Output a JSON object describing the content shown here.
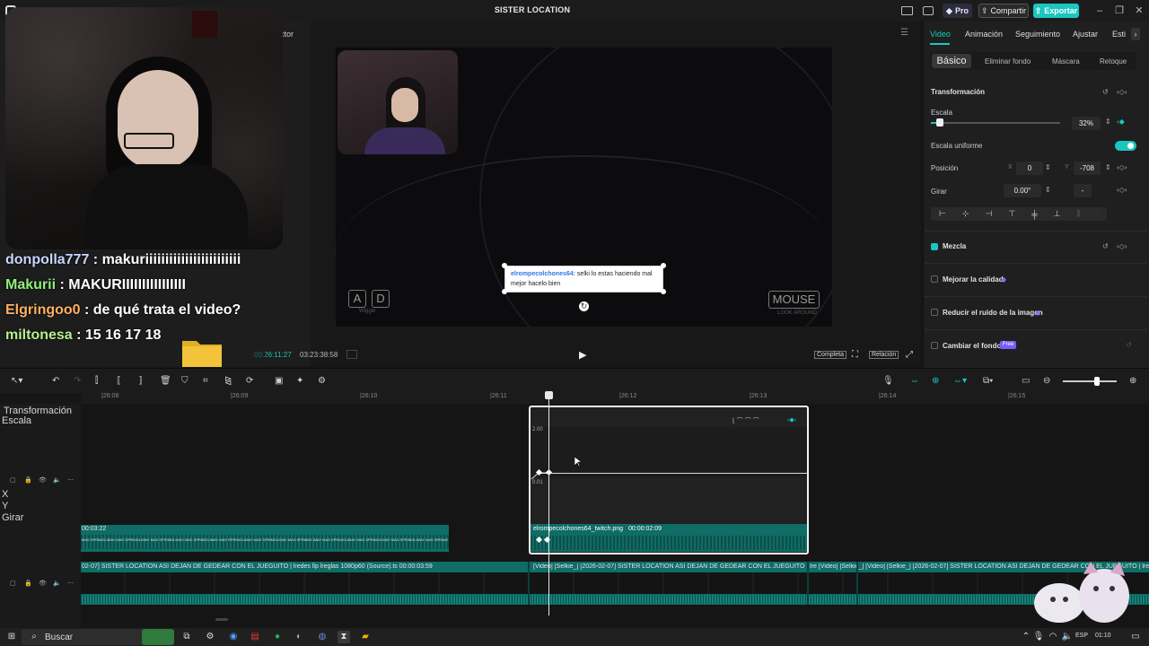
{
  "window": {
    "title": "SISTER LOCATION",
    "pro_label": "Pro",
    "share_label": "Compartir",
    "export_label": "Exportar"
  },
  "player": {
    "tab_label": "ctor",
    "current_time": "00:26:11:27",
    "total_time": "03:23:38:58",
    "complete_label": "Completa",
    "ratio_label": "Relación",
    "chat_user": "elrompecolchones64:",
    "chat_msg": "selki lo estas haciendo mal mejor hacelo bien",
    "key_a": "A",
    "key_d": "D",
    "key_sub": "Wiggle",
    "mouse_label": "MOUSE",
    "mouse_sub": "LOOK AROUND"
  },
  "stream_chat": [
    {
      "user": "donpolla777",
      "msg": " : makuriiiiiiiiiiiiiiiiiiiiiiii"
    },
    {
      "user": "Makurii",
      "msg": " : MAKURIIIIIIIIIIIIIIII"
    },
    {
      "user": "Elgringoo0",
      "msg": " : de qué trata el video?"
    },
    {
      "user": "miltonesa",
      "msg": " : 15 16 17 18"
    }
  ],
  "props": {
    "tabs": [
      "Video",
      "Animación",
      "Seguimiento",
      "Ajustar",
      "Esti"
    ],
    "subtabs": [
      "Básico",
      "Eliminar fondo",
      "Máscara",
      "Retoque"
    ],
    "transform_title": "Transformación",
    "scale_label": "Escala",
    "scale_value": "32%",
    "scale_fraction": 0.07,
    "uniform_label": "Escala uniforme",
    "position_label": "Posición",
    "pos_x_label": "X",
    "pos_x": "0",
    "pos_y_label": "Y",
    "pos_y": "-708",
    "rotate_label": "Girar",
    "rotate_value": "0.00°",
    "rotate_extra": "-",
    "mix_label": "Mezcla",
    "quality_label": "Mejorar la calidad",
    "noise_label": "Reducir el ruido de la imagen",
    "bg_label": "Cambiar el fondo",
    "free_badge": "Free"
  },
  "timeline": {
    "ticks": [
      "|26:08",
      "|26:09",
      "|26:10",
      "|26:11",
      "|26:12",
      "|26:13",
      "|26:14",
      "|26:15"
    ],
    "clip_left_time": "00:03:22",
    "clip_left_text": "MAS SPRIMGLIMAY MAS SPRIMGLIMAY MAS SPRIMGLIMAY MAS SPRIMGLIMAY MAS SPRIMGLIMAY MAS SPRIMGLIMAY MAS SPRIMGLIMAY MAS SPRIMGLIMAY MAS SPRIMGLIMAY MAS SPRIMGLIMAY MAS SPRIMGLIMAY",
    "kf_header": "Transformación",
    "kf_scale": "Escala",
    "kf_top_value": "2.00",
    "kf_bottom_value": "0.01",
    "kf_x": "X",
    "kf_y": "Y",
    "kf_rotate": "Girar",
    "kf_clip_label": "elrompecolchones64_twitch.png",
    "kf_clip_time": "00:00:02:09",
    "main_clip_text1": "02-07] SISTER LOCATION ASI DEJAN DE GEDEAR CON EL JUEGUITO  |  lredes llp lreglas 1080p60 (Source).ts    00:00:03:59",
    "main_clip_text2": "[Video] [Selkie_] [2026-02-07] SISTER LOCATION ASI DEJAN DE GEDEAR CON EL JUEGUITO  |  lre  [Video] [Selkie_]  [Video] [Selkie_] [2026-02-07] SISTER LOCATION ASI DEJAN DE GEDEAR CON EL JUEGUITO  |  lrede"
  },
  "taskbar": {
    "search_label": "Buscar",
    "lang": "ESP",
    "time": "01:10"
  },
  "colors": {
    "accent": "#19c7c0",
    "clip": "#0f6c66"
  }
}
